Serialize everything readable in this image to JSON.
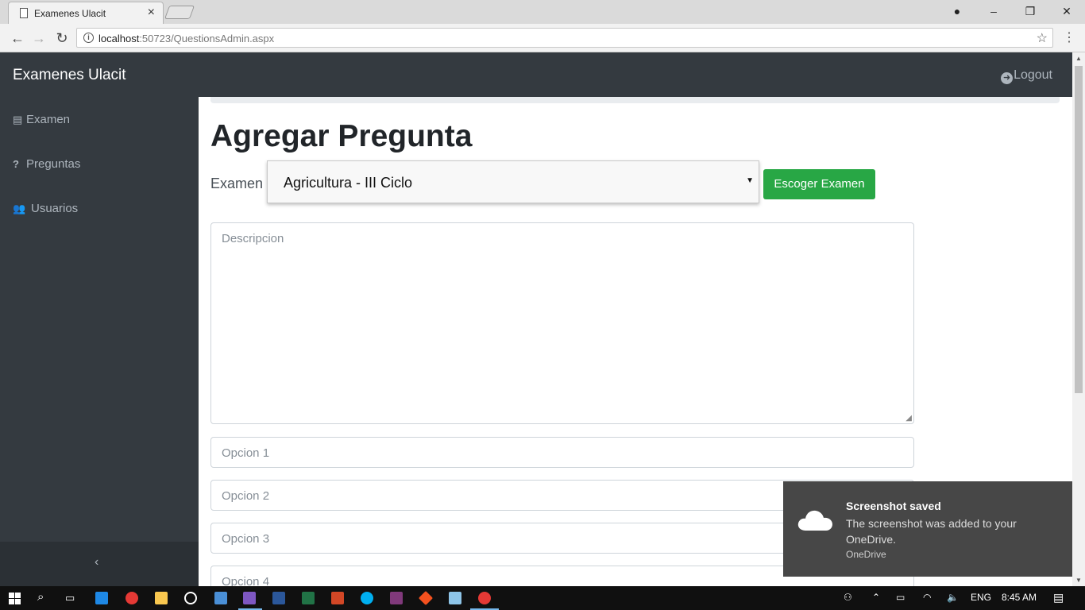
{
  "browser": {
    "tab_title": "Examenes Ulacit",
    "url_host": "localhost",
    "url_rest": ":50723/QuestionsAdmin.aspx"
  },
  "app": {
    "brand": "Examenes Ulacit",
    "logout_label": "Logout"
  },
  "sidebar": {
    "items": [
      {
        "label": "Examen",
        "icon": "file-icon"
      },
      {
        "label": "Preguntas",
        "icon": "question-icon"
      },
      {
        "label": "Usuarios",
        "icon": "users-icon"
      }
    ]
  },
  "main": {
    "title": "Agregar Pregunta",
    "exam_label": "Examen",
    "exam_selected": "Agricultura - III Ciclo",
    "choose_button": "Escoger Examen",
    "description_placeholder": "Descripcion",
    "options": [
      "Opcion 1",
      "Opcion 2",
      "Opcion 3",
      "Opcion 4"
    ]
  },
  "toast": {
    "title": "Screenshot saved",
    "body": "The screenshot was added to your OneDrive.",
    "source": "OneDrive"
  },
  "taskbar": {
    "language": "ENG",
    "time": "8:45 AM"
  },
  "colors": {
    "topbar": "#343a40",
    "success": "#28a745",
    "toast": "#474747"
  }
}
